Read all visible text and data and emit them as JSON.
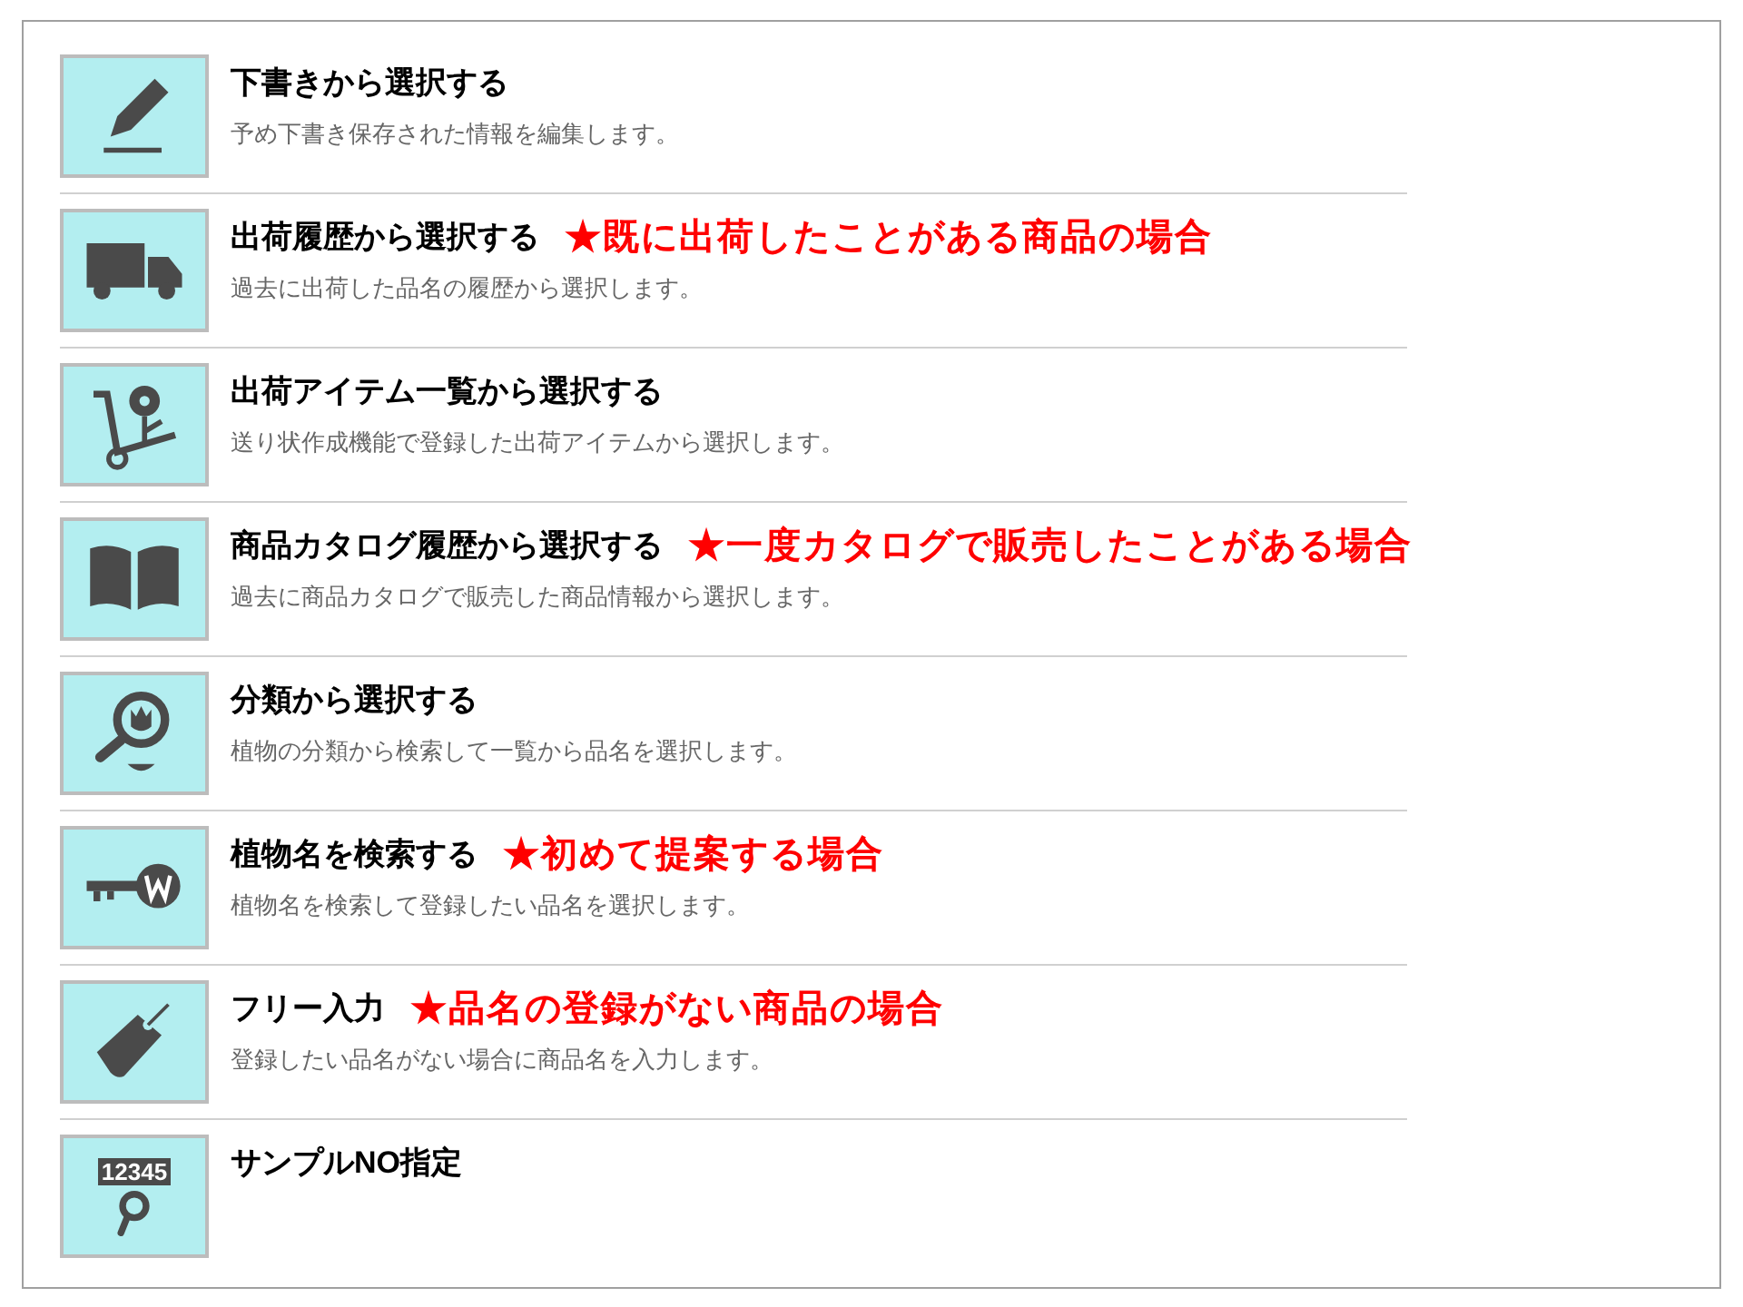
{
  "options": [
    {
      "title": "下書きから選択する",
      "description": "予め下書き保存された情報を編集します。"
    },
    {
      "title": "出荷履歴から選択する",
      "note": "★既に出荷したことがある商品の場合",
      "description": "過去に出荷した品名の履歴から選択します。"
    },
    {
      "title": "出荷アイテム一覧から選択する",
      "description": "送り状作成機能で登録した出荷アイテムから選択します。"
    },
    {
      "title": "商品カタログ履歴から選択する",
      "note": "★一度カタログで販売したことがある場合",
      "description": "過去に商品カタログで販売した商品情報から選択します。"
    },
    {
      "title": "分類から選択する",
      "description": "植物の分類から検索して一覧から品名を選択します。"
    },
    {
      "title": "植物名を検索する",
      "note": "★初めて提案する場合",
      "description": "植物名を検索して登録したい品名を選択します。"
    },
    {
      "title": "フリー入力",
      "note": "★品名の登録がない商品の場合",
      "description": "登録したい品名がない場合に商品名を入力します。"
    },
    {
      "icon_text": "12345",
      "title": "サンプルNO指定"
    }
  ]
}
